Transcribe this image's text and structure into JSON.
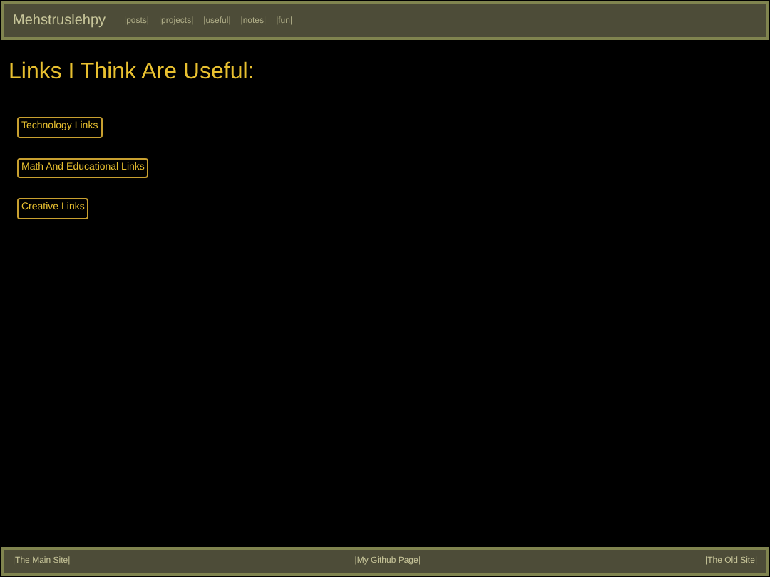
{
  "header": {
    "site_title": "Mehstruslehpy",
    "nav": [
      "|posts|",
      "|projects|",
      "|useful|",
      "|notes|",
      "|fun|"
    ]
  },
  "heading": "Links I Think Are Useful:",
  "links": [
    "Technology Links",
    "Math And Educational Links",
    "Creative Links"
  ],
  "footer": [
    "|The Main Site|",
    "|My Github Page|",
    "|The Old Site|"
  ]
}
